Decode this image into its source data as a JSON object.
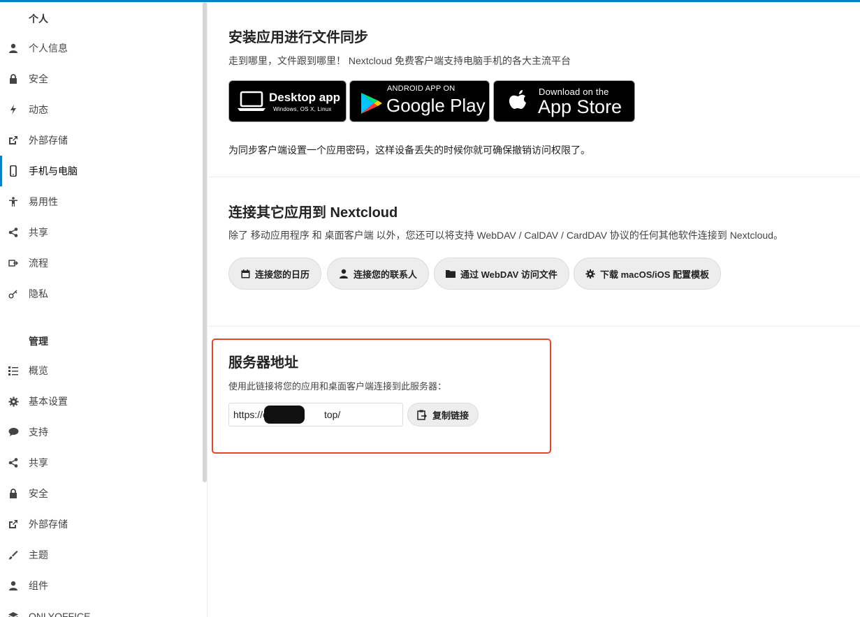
{
  "sidebar": {
    "personal_caption": "个人",
    "admin_caption": "管理",
    "personal_items": [
      {
        "label": "个人信息",
        "icon": "user-icon"
      },
      {
        "label": "安全",
        "icon": "lock-icon"
      },
      {
        "label": "动态",
        "icon": "lightning-icon"
      },
      {
        "label": "外部存储",
        "icon": "external-link-icon"
      },
      {
        "label": "手机与电脑",
        "icon": "phone-icon",
        "active": true
      },
      {
        "label": "易用性",
        "icon": "accessibility-icon"
      },
      {
        "label": "共享",
        "icon": "share-icon"
      },
      {
        "label": "流程",
        "icon": "flow-icon"
      },
      {
        "label": "隐私",
        "icon": "key-icon"
      }
    ],
    "admin_items": [
      {
        "label": "概览",
        "icon": "list-icon"
      },
      {
        "label": "基本设置",
        "icon": "gear-icon"
      },
      {
        "label": "支持",
        "icon": "speech-bubble-icon"
      },
      {
        "label": "共享",
        "icon": "share-icon"
      },
      {
        "label": "安全",
        "icon": "lock-icon"
      },
      {
        "label": "外部存储",
        "icon": "external-link-icon"
      },
      {
        "label": "主题",
        "icon": "brush-icon"
      },
      {
        "label": "组件",
        "icon": "user-icon"
      },
      {
        "label": "ONLYOFFICE",
        "icon": "layers-icon"
      }
    ]
  },
  "sync": {
    "title": "安装应用进行文件同步",
    "description": "走到哪里，文件跟到哪里！ Nextcloud 免费客户端支持电脑手机的各大主流平台",
    "desktop_badge": {
      "main": "Desktop app",
      "sub": "Windows, OS X, Linux"
    },
    "google_badge": {
      "top": "ANDROID APP ON",
      "main": "Google Play"
    },
    "apple_badge": {
      "top": "Download on the",
      "main": "App Store"
    },
    "app_password_note": "为同步客户端设置一个应用密码，这样设备丢失的时候你就可确保撤销访问权限了。"
  },
  "connect": {
    "title": "连接其它应用到 Nextcloud",
    "description": "除了 移动应用程序 和 桌面客户端 以外，您还可以将支持 WebDAV / CalDAV / CardDAV 协议的任何其他软件连接到 Nextcloud。",
    "buttons": {
      "calendar": "连接您的日历",
      "contacts": "连接您的联系人",
      "webdav": "通过 WebDAV 访问文件",
      "macos": "下载 macOS/iOS 配置模板"
    }
  },
  "server": {
    "title": "服务器地址",
    "description": "使用此链接将您的应用和桌面客户端连接到此服务器：",
    "url": "https://cloud              top/",
    "copy_label": "复制链接"
  },
  "colors": {
    "accent": "#0082c9",
    "highlight_border": "#e8412c"
  }
}
